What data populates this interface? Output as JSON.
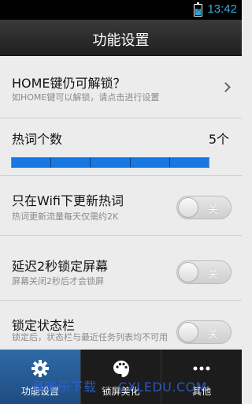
{
  "status_bar": {
    "time": "13:42"
  },
  "header": {
    "title": "功能设置"
  },
  "settings": {
    "home_unlock": {
      "label": "HOME键仍可解锁？",
      "desc": "如HOME键可以解锁，请点击进行设置"
    },
    "hotword_count": {
      "label": "热词个数",
      "value": "5个",
      "level": 5,
      "max": 5
    },
    "wifi_update": {
      "label": "只在Wifi下更新热词",
      "desc": "热词更新流量每天仅需约2K",
      "state": "关"
    },
    "delay_lock": {
      "label": "延迟2秒锁定屏幕",
      "desc": "屏幕关闭2秒后才会锁屏",
      "state": "关"
    },
    "lock_statusbar": {
      "label": "锁定状态栏",
      "desc": "锁定后，状态栏与最近任务列表均不可用",
      "state": "关"
    }
  },
  "tabs": [
    {
      "label": "功能设置",
      "icon": "gear-icon",
      "active": true
    },
    {
      "label": "锁屏美化",
      "icon": "palette-icon",
      "active": false
    },
    {
      "label": "其他",
      "icon": "more-dots-icon",
      "active": false
    }
  ],
  "watermark": "晨曦乐下载 — CXLEDU.COM"
}
